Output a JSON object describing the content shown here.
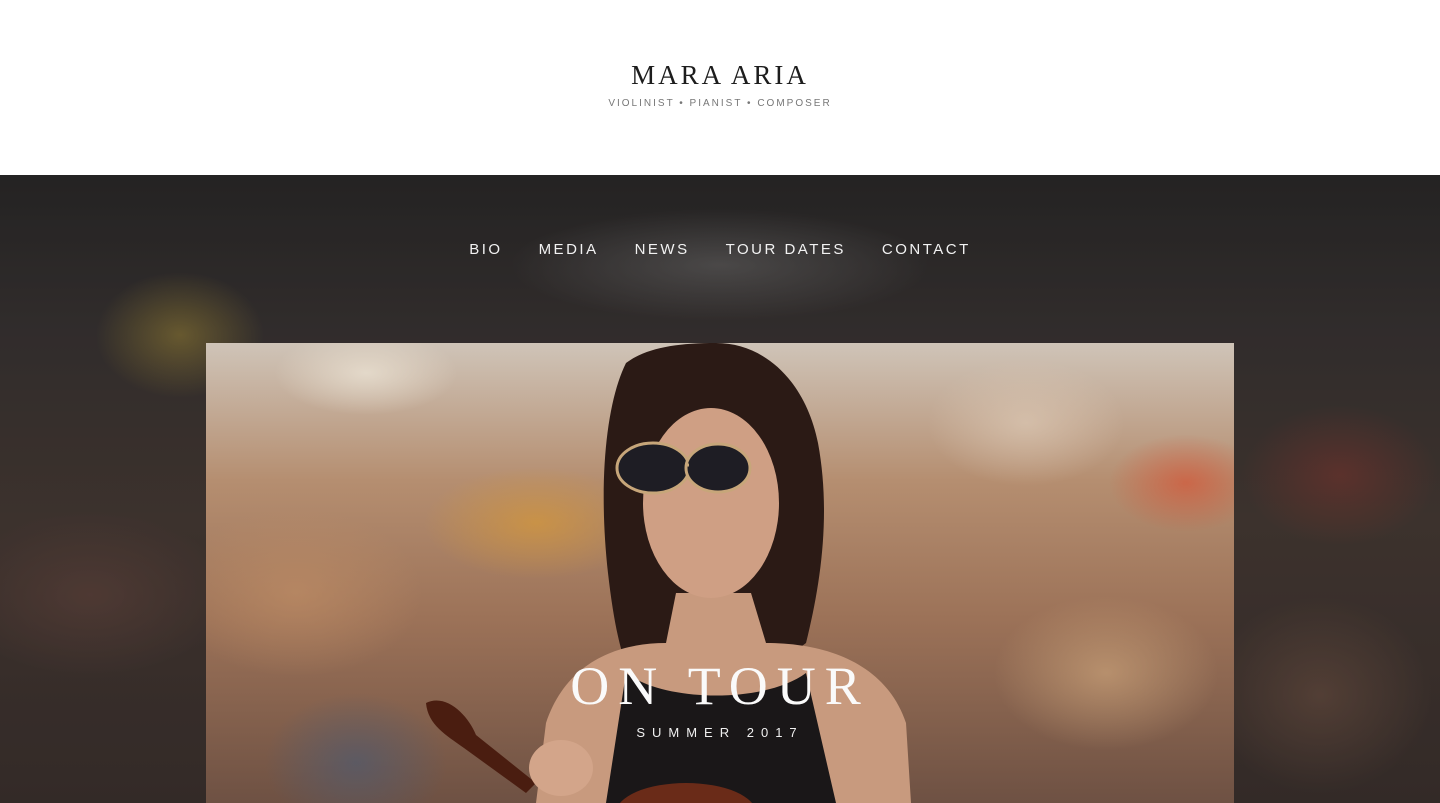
{
  "site": {
    "title": "MARA ARIA",
    "tagline": "VIOLINIST • PIANIST • COMPOSER"
  },
  "nav": {
    "items": [
      {
        "label": "BIO"
      },
      {
        "label": "MEDIA"
      },
      {
        "label": "NEWS"
      },
      {
        "label": "TOUR DATES"
      },
      {
        "label": "CONTACT"
      }
    ]
  },
  "feature": {
    "title": "ON TOUR",
    "subtitle": "SUMMER 2017"
  },
  "colors": {
    "nav_text": "#f2f2f2",
    "title_text": "#1d1d1d",
    "tagline_text": "#777777"
  },
  "icons": {
    "hero_image": "blurred-crowd-photo",
    "portrait_image": "woman-with-violin-photo"
  }
}
